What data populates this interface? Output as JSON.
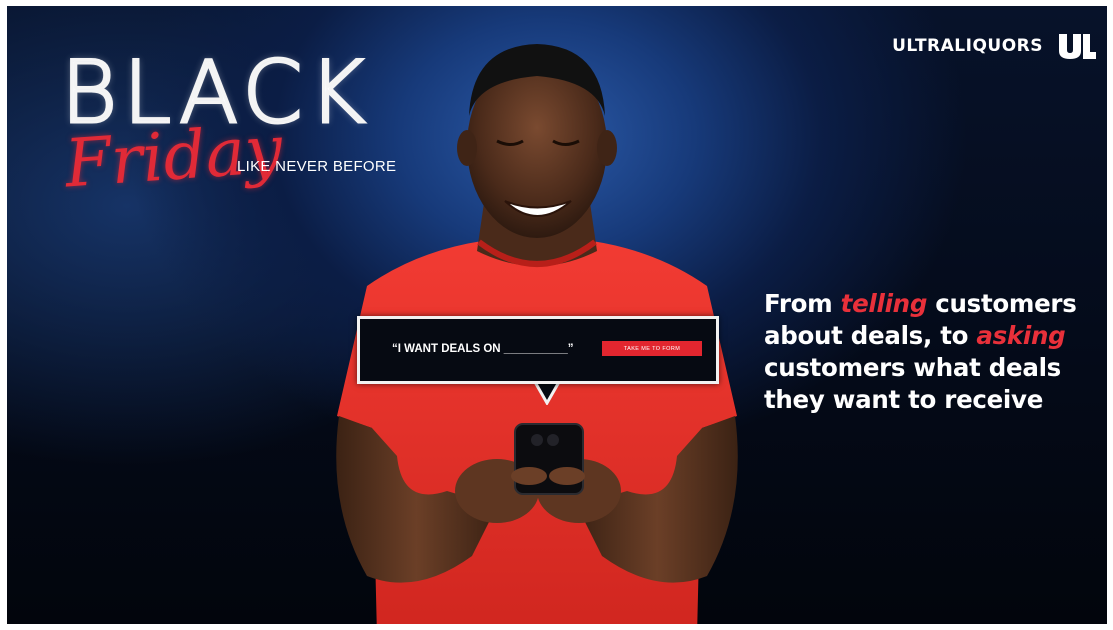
{
  "brand": {
    "name": "ULTRALIQUORS",
    "logo_text": "UL"
  },
  "headline": {
    "black": "BLACK",
    "friday": "Friday",
    "tagline": "LIKE NEVER BEFORE"
  },
  "bubble": {
    "prompt": "“I WANT DEALS ON __________”",
    "button_label": "TAKE ME TO FORM"
  },
  "copy": {
    "part1": "From ",
    "accent1": "telling",
    "part2": " customers about deals, to ",
    "accent2": "asking",
    "part3": " customers what deals they want to receive"
  },
  "colors": {
    "accent_red": "#e2262f",
    "background_navy": "#07122a",
    "shirt_red": "#e8342f",
    "text_white": "#ffffff"
  }
}
